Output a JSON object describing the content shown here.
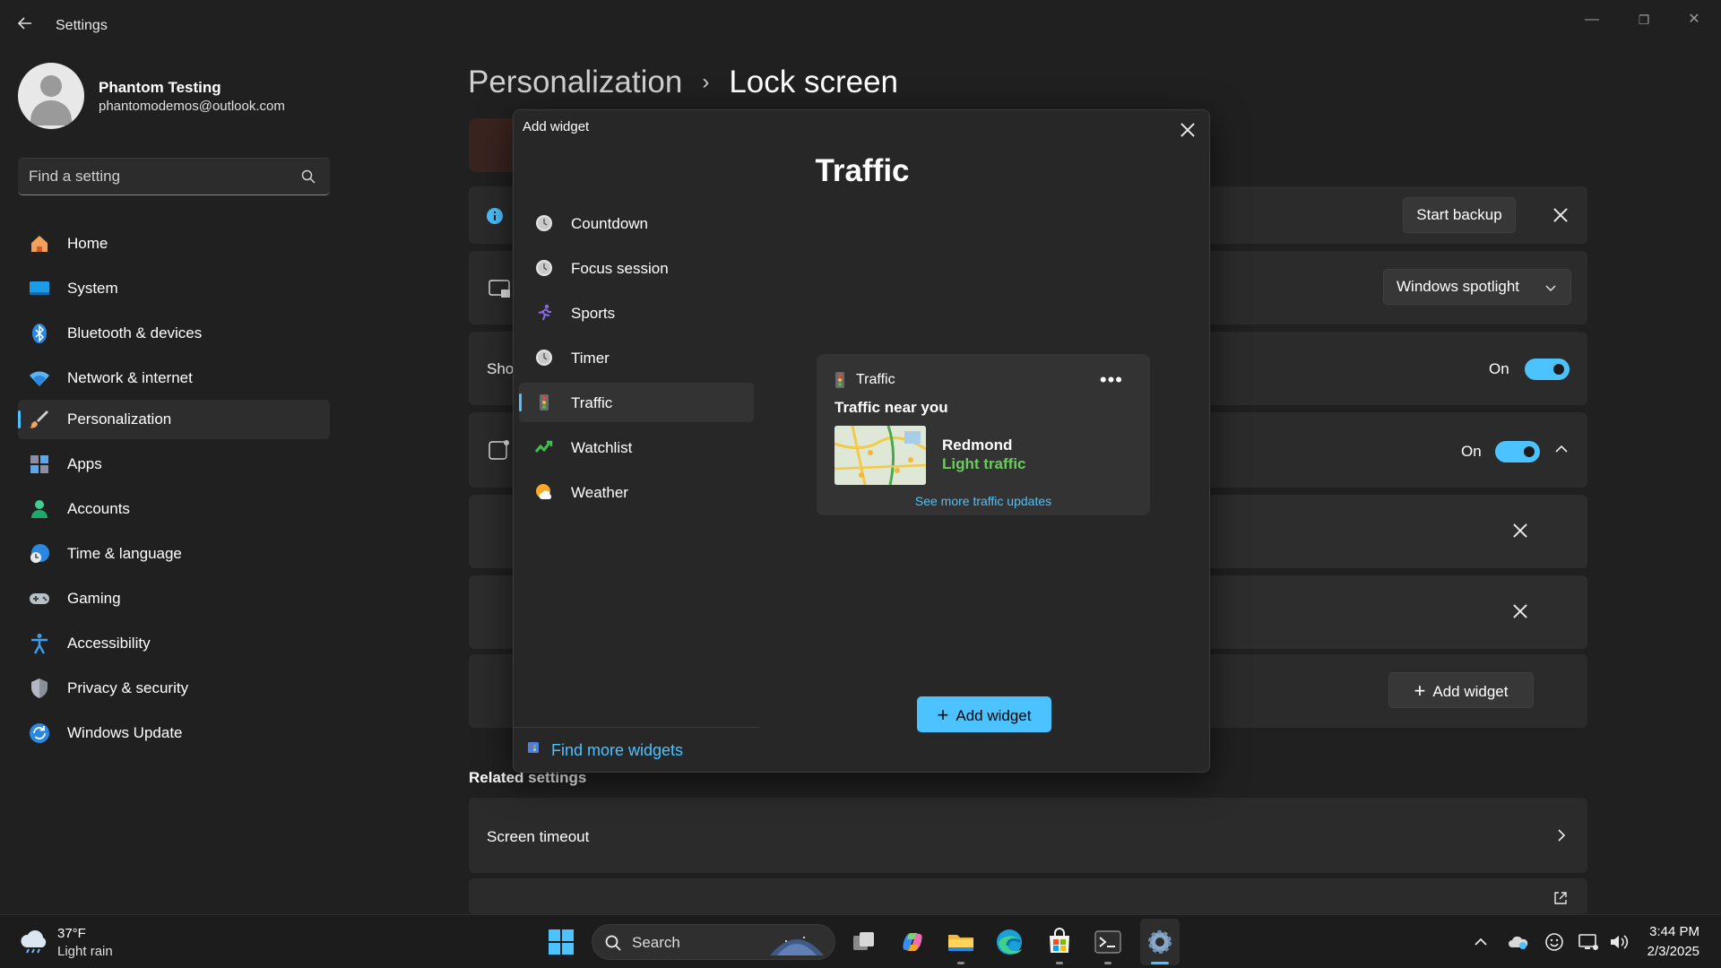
{
  "window": {
    "title": "Settings",
    "back_icon": "back-arrow-icon",
    "minimize": "—",
    "maximize": "❐",
    "close": "✕"
  },
  "profile": {
    "name": "Phantom Testing",
    "email": "phantomodemos@outlook.com"
  },
  "search": {
    "placeholder": "Find a setting"
  },
  "nav": {
    "items": [
      {
        "label": "Home",
        "icon": "home-icon"
      },
      {
        "label": "System",
        "icon": "system-icon"
      },
      {
        "label": "Bluetooth & devices",
        "icon": "bluetooth-icon"
      },
      {
        "label": "Network & internet",
        "icon": "wifi-icon"
      },
      {
        "label": "Personalization",
        "icon": "paintbrush-icon",
        "active": true
      },
      {
        "label": "Apps",
        "icon": "apps-icon"
      },
      {
        "label": "Accounts",
        "icon": "accounts-icon"
      },
      {
        "label": "Time & language",
        "icon": "clock-globe-icon"
      },
      {
        "label": "Gaming",
        "icon": "gamepad-icon"
      },
      {
        "label": "Accessibility",
        "icon": "accessibility-icon"
      },
      {
        "label": "Privacy & security",
        "icon": "shield-icon"
      },
      {
        "label": "Windows Update",
        "icon": "update-icon"
      }
    ]
  },
  "breadcrumb": {
    "parent": "Personalization",
    "separator": "›",
    "current": "Lock screen"
  },
  "main": {
    "backup_button": "Start backup",
    "spotlight_select": "Windows spotlight",
    "show_row_label": "Sho",
    "toggle1_state": "On",
    "toggle2_state": "On",
    "add_widget_button": "Add widget",
    "related_title": "Related settings",
    "screen_timeout": "Screen timeout",
    "accent_color": "#4cc2ff"
  },
  "modal": {
    "title": "Add widget",
    "preview_title": "Traffic",
    "widgets": [
      {
        "label": "Countdown",
        "icon": "clock-icon"
      },
      {
        "label": "Focus session",
        "icon": "clock-icon"
      },
      {
        "label": "Sports",
        "icon": "runner-icon"
      },
      {
        "label": "Timer",
        "icon": "clock-icon"
      },
      {
        "label": "Traffic",
        "icon": "traffic-light-icon",
        "active": true
      },
      {
        "label": "Watchlist",
        "icon": "stock-chart-icon"
      },
      {
        "label": "Weather",
        "icon": "sun-cloud-icon"
      }
    ],
    "find_more": "Find more widgets",
    "add_button": "Add widget",
    "traffic_card": {
      "name": "Traffic",
      "more": "•••",
      "heading": "Traffic near you",
      "city": "Redmond",
      "status": "Light traffic",
      "link": "See more traffic updates",
      "status_color": "#6ccb5f"
    }
  },
  "taskbar": {
    "weather_temp": "37°F",
    "weather_cond": "Light rain",
    "search_label": "Search",
    "time": "3:44 PM",
    "date": "2/3/2025"
  }
}
